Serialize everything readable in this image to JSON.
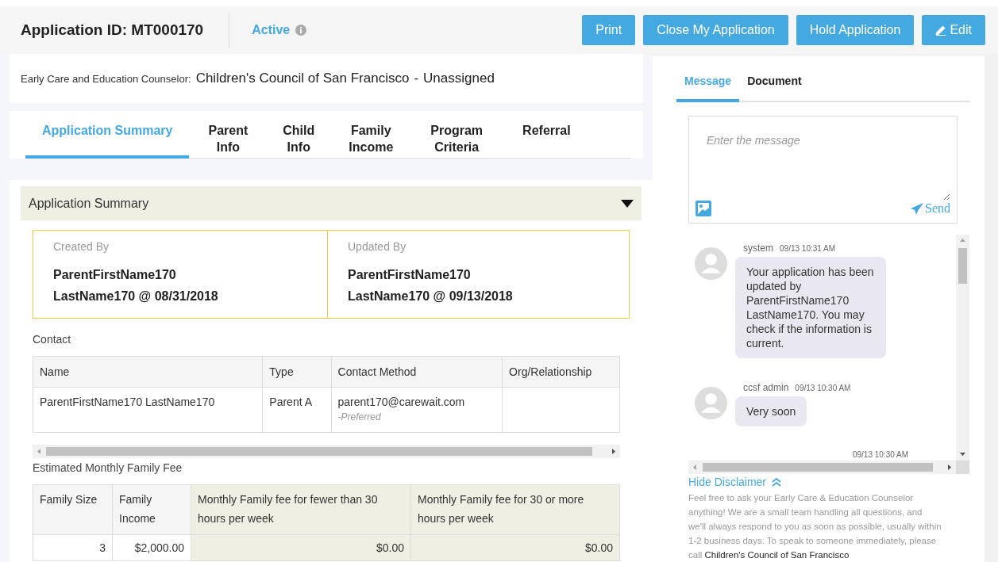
{
  "header": {
    "title": "Application ID: MT000170",
    "status": "Active",
    "buttons": [
      {
        "label": "Print",
        "kind": "plain"
      },
      {
        "label": "Close My Application",
        "kind": "plain"
      },
      {
        "label": "Hold Application",
        "kind": "plain"
      },
      {
        "label": "Edit",
        "kind": "edit"
      }
    ]
  },
  "counselor": {
    "label": "Early Care and Education Counselor:",
    "agency": "Children's Council of San Francisco",
    "separator": "-",
    "assignee": "Unassigned"
  },
  "tabs": [
    {
      "lines": [
        "Application Summary"
      ],
      "selected": true
    },
    {
      "lines": [
        "Parent",
        "Info"
      ],
      "selected": false
    },
    {
      "lines": [
        "Child",
        "Info"
      ],
      "selected": false
    },
    {
      "lines": [
        "Family",
        "Income"
      ],
      "selected": false
    },
    {
      "lines": [
        "Program",
        "Criteria"
      ],
      "selected": false
    },
    {
      "lines": [
        "Referral"
      ],
      "selected": false
    }
  ],
  "section": {
    "title": "Application Summary",
    "expanded": true
  },
  "summary": [
    {
      "label": "Created By",
      "lines": [
        "ParentFirstName170",
        "LastName170 @ 08/31/2018"
      ]
    },
    {
      "label": "Updated By",
      "lines": [
        "ParentFirstName170",
        "LastName170 @ 09/13/2018"
      ]
    }
  ],
  "contact": {
    "label": "Contact",
    "columns": [
      "Name",
      "Type",
      "Contact Method",
      "Org/Relationship"
    ],
    "rows": [
      {
        "name": "ParentFirstName170 LastName170",
        "type": "Parent A",
        "method": "parent170@carewait.com",
        "note": "-Preferred"
      }
    ]
  },
  "fee": {
    "label": "Estimated Monthly Family Fee",
    "columns": [
      "Family Size",
      "Family Income",
      "Monthly Family fee for fewer than 30 hours per week",
      "Monthly Family fee for 30 or more hours per week"
    ],
    "rows": [
      {
        "size": "3",
        "income": "$2,000.00",
        "fee_under_30": "$0.00",
        "fee_30_plus": "$0.00"
      }
    ]
  },
  "panel": {
    "tabs": [
      {
        "label": "Message",
        "selected": true
      },
      {
        "label": "Document",
        "selected": false
      }
    ],
    "placeholder": "Enter the message",
    "send": "Send",
    "messages": [
      {
        "kind": "incoming",
        "sender": "system",
        "time": "09/13 10:31 AM",
        "text": "Your application has been updated by ParentFirstName170 LastName170. You may check if the information is current."
      },
      {
        "kind": "incoming",
        "sender": "ccsf admin",
        "time": "09/13 10:30 AM",
        "text": "Very soon"
      },
      {
        "kind": "outgoing",
        "time": "09/13 10:30 AM"
      }
    ],
    "disclaimer": {
      "toggle": "Hide Disclaimer",
      "text": "Feel free to ask your Early Care & Education Counselor anything! We are a small team handling all questions, and we'll always respond to you as soon as possible, usually within 1-2 business days. To speak to someone immediately, please call",
      "link": "Children's Council of San Francisco"
    }
  }
}
